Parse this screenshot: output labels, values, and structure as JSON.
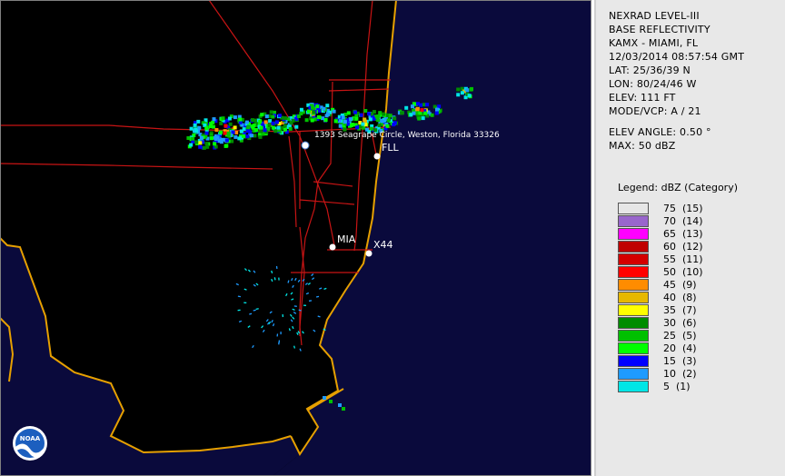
{
  "info": {
    "product": "NEXRAD LEVEL-III",
    "type": "BASE REFLECTIVITY",
    "station": "KAMX - MIAMI, FL",
    "datetime": "12/03/2014 08:57:54 GMT",
    "lat": "LAT: 25/36/39 N",
    "lon": "LON: 80/24/46 W",
    "elev": "ELEV: 111 FT",
    "mode": "MODE/VCP: A / 21",
    "elev_angle": "ELEV ANGLE: 0.50 °",
    "max": "MAX: 50 dBZ"
  },
  "legend": {
    "title": "Legend: dBZ (Category)",
    "items": [
      {
        "label": "75  (15)",
        "color": "#e6e6e6"
      },
      {
        "label": "70  (14)",
        "color": "#9966cc"
      },
      {
        "label": "65  (13)",
        "color": "#ff00ff"
      },
      {
        "label": "60  (12)",
        "color": "#c00000"
      },
      {
        "label": "55  (11)",
        "color": "#d40000"
      },
      {
        "label": "50  (10)",
        "color": "#ff0000"
      },
      {
        "label": "45  (9)",
        "color": "#ff8c00"
      },
      {
        "label": "40  (8)",
        "color": "#e6b800"
      },
      {
        "label": "35  (7)",
        "color": "#ffff00"
      },
      {
        "label": "30  (6)",
        "color": "#008c00"
      },
      {
        "label": "25  (5)",
        "color": "#00c000"
      },
      {
        "label": "20  (4)",
        "color": "#00ff00"
      },
      {
        "label": "15  (3)",
        "color": "#0000ff"
      },
      {
        "label": "10  (2)",
        "color": "#1e9bff"
      },
      {
        "label": "5  (1)",
        "color": "#00e6e6"
      }
    ]
  },
  "map": {
    "place_label": "1393 Seagrape Circle, Weston, Florida 33326",
    "cities": [
      {
        "name": "FLL"
      },
      {
        "name": "MIA"
      },
      {
        "name": "X44"
      }
    ],
    "logo_text": "NOAA"
  }
}
